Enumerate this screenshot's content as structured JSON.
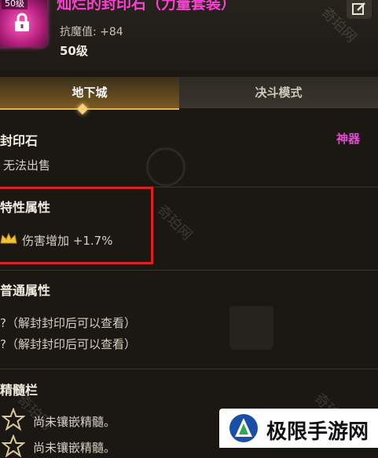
{
  "header": {
    "level_tag": "50级",
    "item_name": "灿烂的封印石（力量套装）",
    "stat_line": "抗魔值: +84",
    "level_line": "50级"
  },
  "tabs": [
    {
      "label": "地下城"
    },
    {
      "label": "决斗模式"
    }
  ],
  "body": {
    "item_type": "封印石",
    "rarity_tag": "神器",
    "sell_status": "无法出售",
    "special_title": "特性属性",
    "special_effect": "伤害增加 +1.7%",
    "normal_title": "普通属性",
    "normal_rows": [
      "?（解封封印后可以查看）",
      "?（解封封印后可以查看）"
    ],
    "socket_title": "精髓栏",
    "socket_rows": [
      "尚未镶嵌精髓。",
      "尚未镶嵌精髓。"
    ]
  },
  "watermarks": [
    "奇珀网",
    "奇珀网",
    "奇珀网",
    "奇珀网"
  ],
  "brand": {
    "text": "极限手游网"
  },
  "colors": {
    "accent_pink": "#ff3fd4",
    "highlight_red": "#e0201a",
    "tab_gold": "#e6b34a"
  }
}
